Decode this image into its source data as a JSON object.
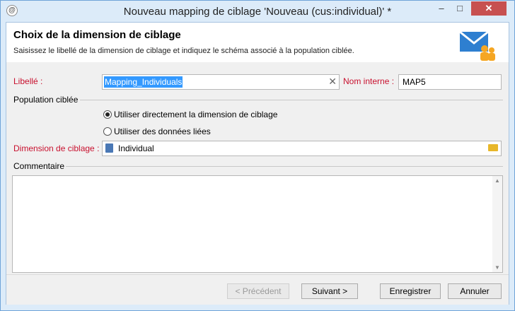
{
  "window": {
    "title": "Nouveau mapping de ciblage 'Nouveau (cus:individual)' *"
  },
  "header": {
    "title": "Choix de la dimension de ciblage",
    "subtitle": "Saisissez le libellé de la dimension de ciblage et indiquez le schéma associé à la population ciblée."
  },
  "form": {
    "libelle_label": "Libellé :",
    "libelle_value": "Mapping_Individuals",
    "nom_interne_label": "Nom interne :",
    "nom_interne_value": "MAP5",
    "population_label": "Population ciblée",
    "radio_direct": "Utiliser directement la dimension de ciblage",
    "radio_linked": "Utiliser des données liées",
    "dimension_label": "Dimension de ciblage :",
    "dimension_value": "Individual",
    "commentaire_label": "Commentaire"
  },
  "buttons": {
    "previous": "< Précédent",
    "next": "Suivant >",
    "save": "Enregistrer",
    "cancel": "Annuler"
  }
}
